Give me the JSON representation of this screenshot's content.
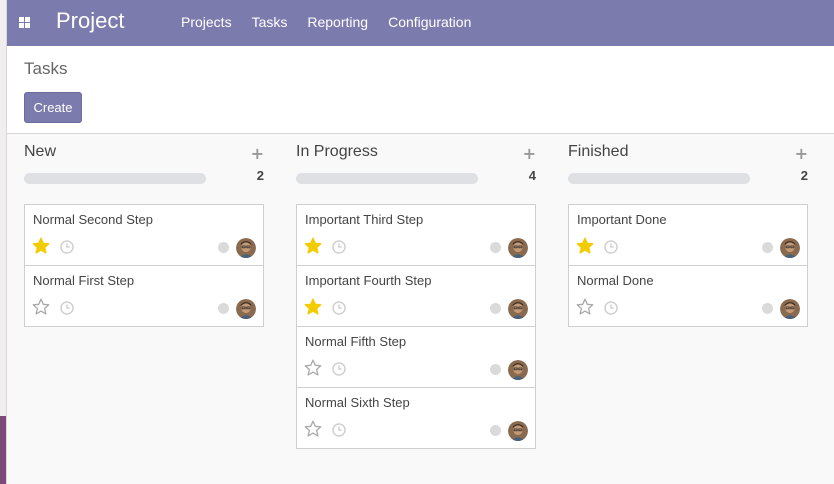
{
  "navbar": {
    "brand": "Project",
    "menu": [
      {
        "label": "Projects"
      },
      {
        "label": "Tasks"
      },
      {
        "label": "Reporting"
      },
      {
        "label": "Configuration"
      }
    ],
    "apps_icon": "apps-grid-icon"
  },
  "control": {
    "title": "Tasks",
    "create_label": "Create"
  },
  "colors": {
    "brand": "#7c7bad",
    "star_active": "#f3cc00",
    "star_inactive": "#aaaaaa"
  },
  "columns": [
    {
      "title": "New",
      "count": "2",
      "add_icon": "plus-icon",
      "cards": [
        {
          "title": "Normal Second Step",
          "starred": true
        },
        {
          "title": "Normal First Step",
          "starred": false
        }
      ]
    },
    {
      "title": "In Progress",
      "count": "4",
      "add_icon": "plus-icon",
      "cards": [
        {
          "title": "Important Third Step",
          "starred": true
        },
        {
          "title": "Important Fourth Step",
          "starred": true
        },
        {
          "title": "Normal Fifth Step",
          "starred": false
        },
        {
          "title": "Normal Sixth Step",
          "starred": false
        }
      ]
    },
    {
      "title": "Finished",
      "count": "2",
      "add_icon": "plus-icon",
      "cards": [
        {
          "title": "Important Done",
          "starred": true
        },
        {
          "title": "Normal Done",
          "starred": false
        }
      ]
    }
  ]
}
